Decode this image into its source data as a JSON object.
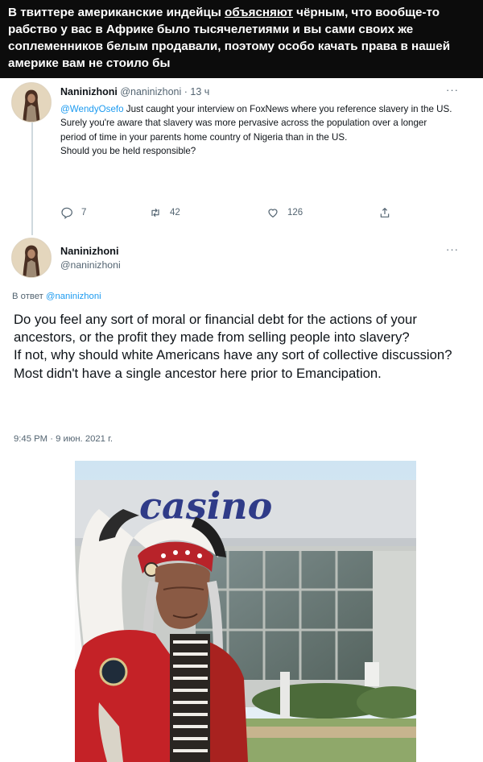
{
  "caption": {
    "part1": "В твиттере американские индейцы ",
    "underlined": "объясняют",
    "part2": " чёрным, что вообще-то рабство у вас в Африке было тысячелетиями и вы сами своих же соплеменников белым продавали, поэтому особо качать права в нашей америке вам не стоило бы"
  },
  "tweet1": {
    "name": "Naninizhoni",
    "handle": "@naninizhoni",
    "separator": "·",
    "time": "13 ч",
    "more": "···",
    "mention": "@WendyOsefo",
    "line1": " Just caught your interview on FoxNews where you reference slavery in the US.",
    "line2": "Surely you're aware that slavery was more pervasive across the population over a longer period of time in your parents home country of Nigeria than in the US.",
    "line3": "Should you be held responsible?",
    "replies": "7",
    "retweets": "42",
    "likes": "126"
  },
  "tweet2": {
    "name": "Naninizhoni",
    "handle": "@naninizhoni",
    "more": "···",
    "reply_prefix": "В ответ ",
    "reply_handle": "@naninizhoni",
    "body_line1": "Do you feel any sort of moral or financial debt for the actions of your ancestors, or the profit they made from selling people into slavery?",
    "body_line2": "If not, why should white Americans have any sort of collective discussion? Most didn't have a single ancestor here prior to Emancipation.",
    "timestamp": "9:45 PM · 9 июн. 2021 г."
  },
  "photo": {
    "sign_text": "casino"
  },
  "colors": {
    "caption_bg": "#0c0c0c",
    "link": "#1d9bf0",
    "muted": "#536471",
    "text": "#0f1419"
  }
}
